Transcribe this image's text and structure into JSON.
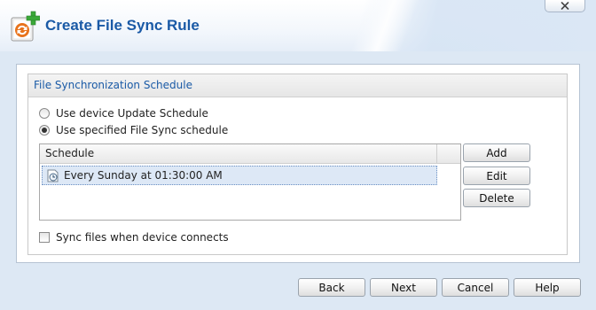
{
  "window": {
    "title": "Create File Sync Rule",
    "close_glyph": "✕"
  },
  "icons": {
    "app_icon": "file-sync-add-icon",
    "close": "close-icon",
    "schedule_row": "clock-document-icon"
  },
  "colors": {
    "title": "#1a5aa6",
    "body_bg": "#dde8f4",
    "selected_row": "#dde8f6",
    "icon_orange": "#e8731c",
    "icon_green": "#3aa839"
  },
  "group": {
    "title": "File Synchronization Schedule",
    "radio_options": [
      {
        "label": "Use device Update Schedule",
        "checked": false
      },
      {
        "label": "Use specified File Sync schedule",
        "checked": true
      }
    ],
    "schedule_list": {
      "column_header": "Schedule",
      "rows": [
        {
          "text": "Every Sunday at 01:30:00 AM",
          "selected": true
        }
      ]
    },
    "side_buttons": {
      "add": "Add",
      "edit": "Edit",
      "delete": "Delete"
    },
    "sync_checkbox": {
      "label": "Sync files when device connects",
      "checked": false
    }
  },
  "footer": {
    "back": "Back",
    "next": "Next",
    "cancel": "Cancel",
    "help": "Help"
  }
}
